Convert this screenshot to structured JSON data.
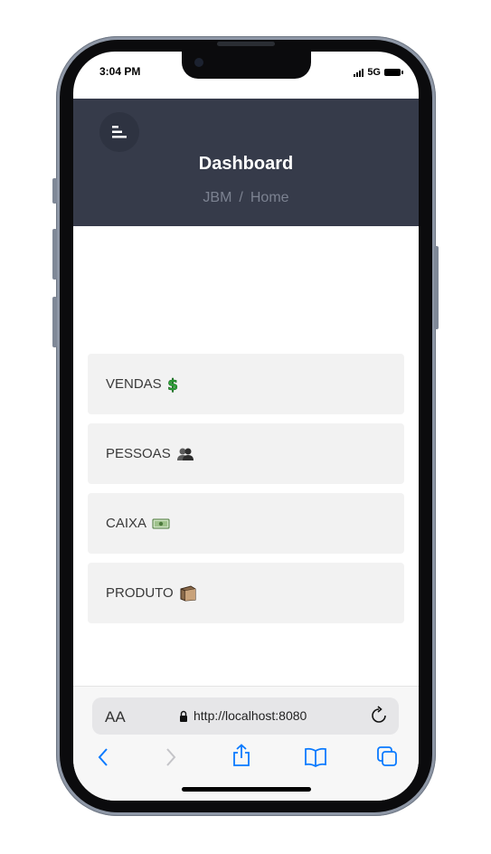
{
  "status_bar": {
    "time": "3:04 PM",
    "network": "5G"
  },
  "header": {
    "title": "Dashboard",
    "breadcrumb": [
      "JBM",
      "Home"
    ],
    "breadcrumb_separator": "/",
    "background_color": "#363b4a"
  },
  "cards": [
    {
      "label": "VENDAS",
      "icon": "dollar-sign-icon"
    },
    {
      "label": "PESSOAS",
      "icon": "people-icon"
    },
    {
      "label": "CAIXA",
      "icon": "cash-icon"
    },
    {
      "label": "PRODUTO",
      "icon": "package-icon"
    }
  ],
  "browser": {
    "aa_label": "AA",
    "url": "http://localhost:8080",
    "accent_color": "#0a7aff"
  }
}
